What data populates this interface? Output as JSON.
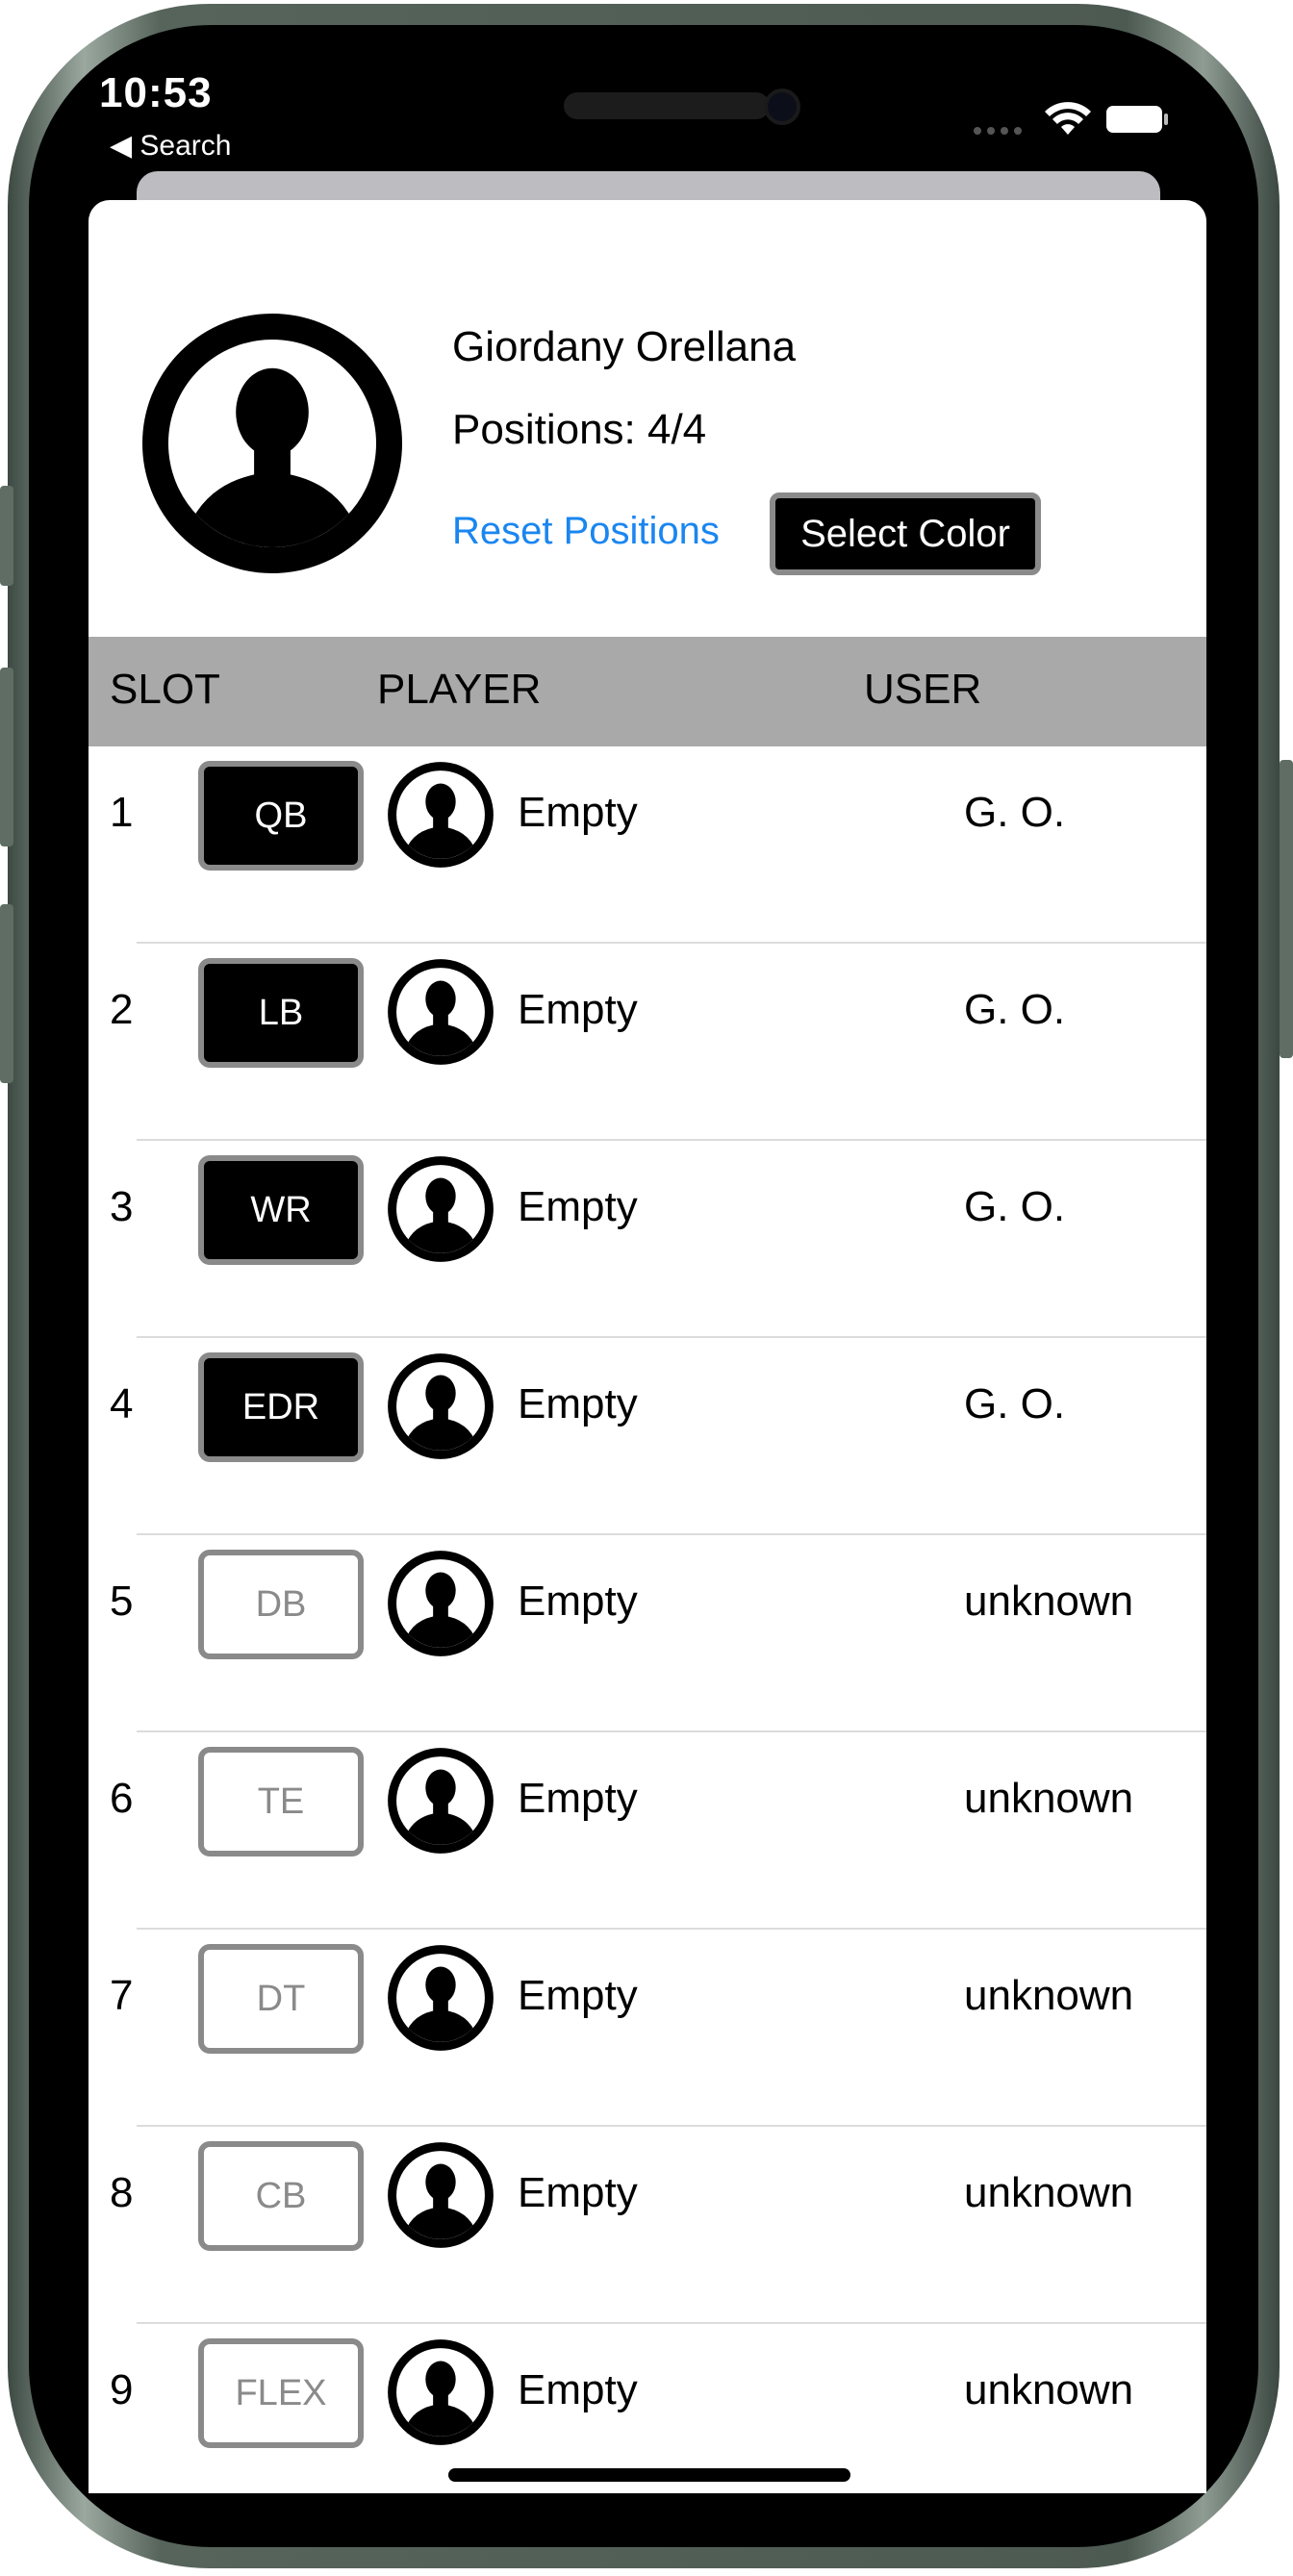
{
  "status_bar": {
    "time": "10:53",
    "back_label": "◀ Search"
  },
  "profile": {
    "name": "Giordany Orellana",
    "positions": "Positions: 4/4",
    "reset_label": "Reset Positions",
    "select_color_label": "Select Color"
  },
  "table": {
    "headers": {
      "slot": "SLOT",
      "player": "PLAYER",
      "user": "USER"
    },
    "rows": [
      {
        "slot": "1",
        "position": "QB",
        "player": "Empty",
        "user": "G. O.",
        "assigned": true
      },
      {
        "slot": "2",
        "position": "LB",
        "player": "Empty",
        "user": "G. O.",
        "assigned": true
      },
      {
        "slot": "3",
        "position": "WR",
        "player": "Empty",
        "user": "G. O.",
        "assigned": true
      },
      {
        "slot": "4",
        "position": "EDR",
        "player": "Empty",
        "user": "G. O.",
        "assigned": true
      },
      {
        "slot": "5",
        "position": "DB",
        "player": "Empty",
        "user": "unknown",
        "assigned": false
      },
      {
        "slot": "6",
        "position": "TE",
        "player": "Empty",
        "user": "unknown",
        "assigned": false
      },
      {
        "slot": "7",
        "position": "DT",
        "player": "Empty",
        "user": "unknown",
        "assigned": false
      },
      {
        "slot": "8",
        "position": "CB",
        "player": "Empty",
        "user": "unknown",
        "assigned": false
      },
      {
        "slot": "9",
        "position": "FLEX",
        "player": "Empty",
        "user": "unknown",
        "assigned": false
      }
    ]
  },
  "colors": {
    "accent_link": "#1a86f0",
    "header_bg": "#a9a9a9",
    "button_border": "#8a8a8a",
    "frame": "#56645b"
  },
  "icons": [
    "avatar-silhouette-icon",
    "wifi-icon",
    "battery-icon",
    "signal-icon",
    "back-triangle-icon"
  ]
}
